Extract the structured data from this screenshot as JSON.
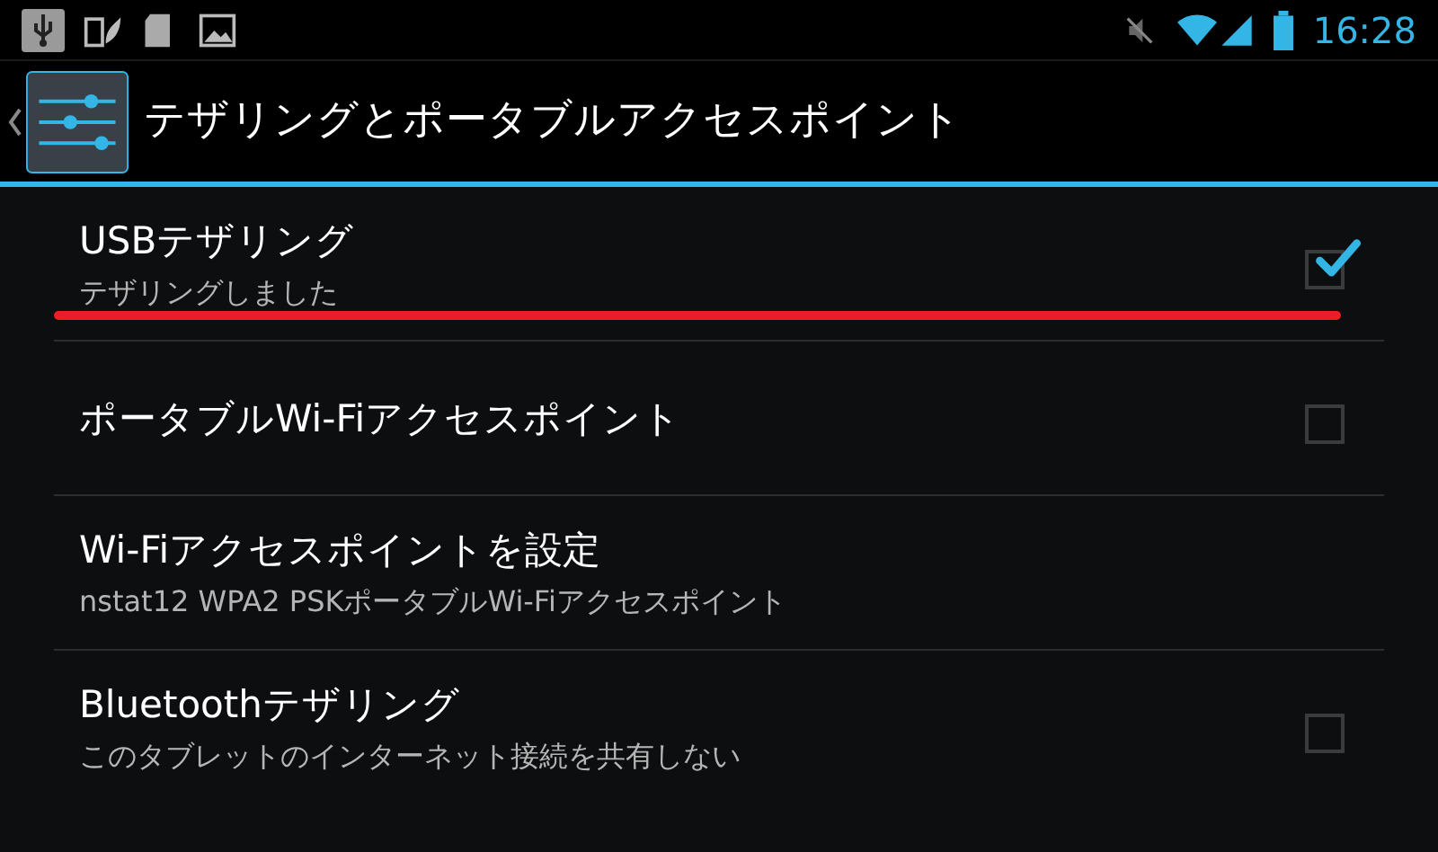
{
  "status_bar": {
    "time": "16:28"
  },
  "action_bar": {
    "title": "テザリングとポータブルアクセスポイント"
  },
  "settings": [
    {
      "kind": "checkbox",
      "title": "USBテザリング",
      "summary": "テザリングしました",
      "checked": true,
      "highlighted": true
    },
    {
      "kind": "checkbox",
      "title": "ポータブルWi-Fiアクセスポイント",
      "checked": false,
      "highlighted": false
    },
    {
      "kind": "plain",
      "title": "Wi-Fiアクセスポイントを設定",
      "summary": "nstat12 WPA2 PSKポータブルWi-Fiアクセスポイント",
      "highlighted": false
    },
    {
      "kind": "checkbox",
      "title": "Bluetoothテザリング",
      "summary": "このタブレットのインターネット接続を共有しない",
      "checked": false,
      "highlighted": false
    }
  ]
}
